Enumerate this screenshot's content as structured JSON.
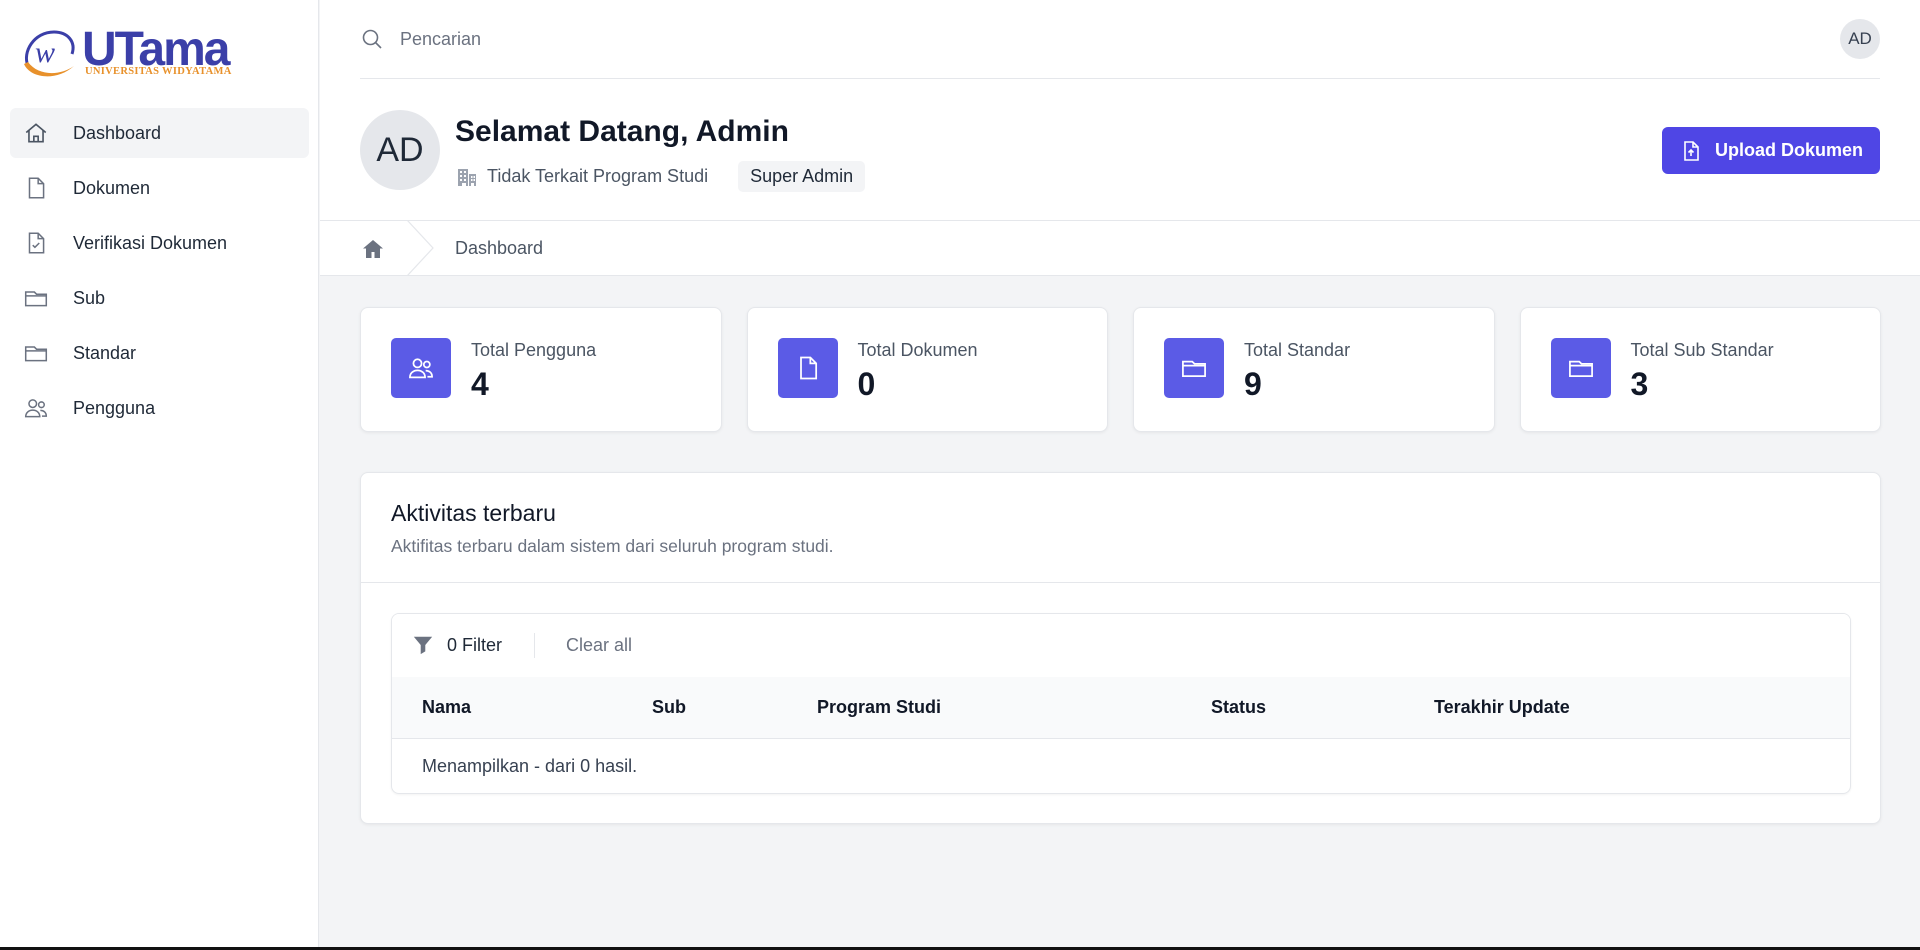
{
  "brand": {
    "name": "UTama",
    "subtitle": "UNIVERSITAS WIDYATAMA",
    "mark": "w"
  },
  "sidebar": {
    "items": [
      {
        "label": "Dashboard",
        "icon": "home-icon",
        "active": true
      },
      {
        "label": "Dokumen",
        "icon": "document-icon"
      },
      {
        "label": "Verifikasi Dokumen",
        "icon": "document-check-icon"
      },
      {
        "label": "Sub",
        "icon": "folder-icon"
      },
      {
        "label": "Standar",
        "icon": "folder-icon"
      },
      {
        "label": "Pengguna",
        "icon": "users-icon"
      }
    ]
  },
  "header": {
    "search_placeholder": "Pencarian",
    "user_initials": "AD"
  },
  "profile": {
    "initials": "AD",
    "welcome": "Selamat Datang, Admin",
    "program": "Tidak Terkait Program Studi",
    "role": "Super Admin"
  },
  "actions": {
    "upload_label": "Upload Dokumen"
  },
  "breadcrumb": {
    "current": "Dashboard"
  },
  "stats": [
    {
      "label": "Total Pengguna",
      "value": "4",
      "icon": "users-icon"
    },
    {
      "label": "Total Dokumen",
      "value": "0",
      "icon": "document-icon"
    },
    {
      "label": "Total Standar",
      "value": "9",
      "icon": "folder-icon"
    },
    {
      "label": "Total Sub Standar",
      "value": "3",
      "icon": "folder-icon"
    }
  ],
  "activity": {
    "title": "Aktivitas terbaru",
    "subtitle": "Aktifitas terbaru dalam sistem dari seluruh program studi.",
    "filter_label": "0 Filter",
    "clear_label": "Clear all",
    "columns": [
      "Nama",
      "Sub",
      "Program Studi",
      "Status",
      "Terakhir Update"
    ],
    "footer": "Menampilkan - dari 0 hasil."
  },
  "colors": {
    "accent": "#4f46e5",
    "stat_icon_bg": "#5b5be6",
    "logo_blue": "#3b3fa8",
    "logo_orange": "#e8912b"
  }
}
